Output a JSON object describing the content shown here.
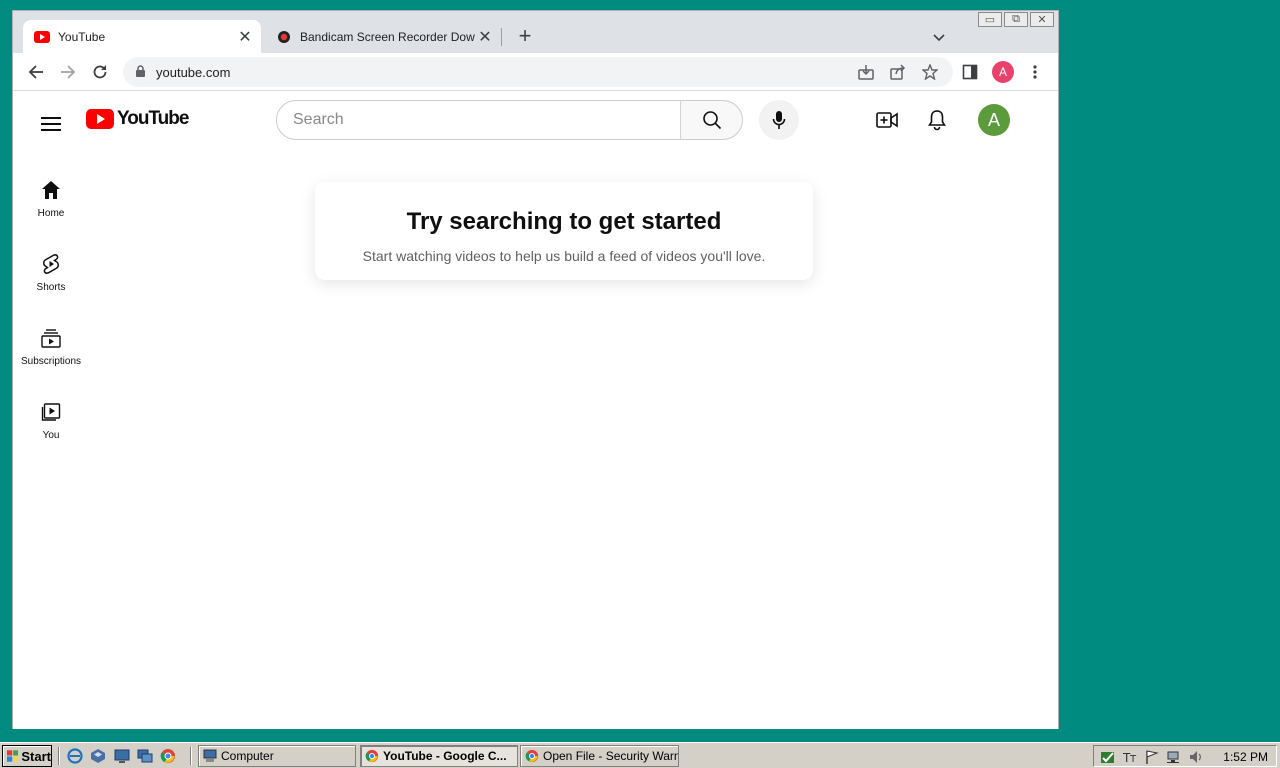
{
  "browser": {
    "tabs": [
      {
        "title": "YouTube",
        "active": true
      },
      {
        "title": "Bandicam Screen Recorder Download",
        "active": false
      }
    ],
    "window_controls": {
      "minimize": "▭",
      "restore": "⧉",
      "close": "✕"
    },
    "address": "youtube.com"
  },
  "youtube": {
    "logo_text": "YouTube",
    "search_placeholder": "Search",
    "avatar_letter": "A",
    "profile_letter": "A",
    "guide": [
      {
        "label": "Home",
        "icon": "home-icon"
      },
      {
        "label": "Shorts",
        "icon": "shorts-icon"
      },
      {
        "label": "Subscriptions",
        "icon": "subscriptions-icon"
      },
      {
        "label": "You",
        "icon": "you-icon"
      }
    ],
    "empty_state": {
      "title": "Try searching to get started",
      "subtitle": "Start watching videos to help us build a feed of videos you'll love."
    },
    "brand_color": "#ff0000"
  },
  "taskbar": {
    "start_label": "Start",
    "tasks": [
      {
        "label": "Computer",
        "active": false
      },
      {
        "label": "YouTube - Google C...",
        "active": true
      },
      {
        "label": "Open File - Security Warni...",
        "active": false
      }
    ],
    "clock": "1:52 PM"
  }
}
